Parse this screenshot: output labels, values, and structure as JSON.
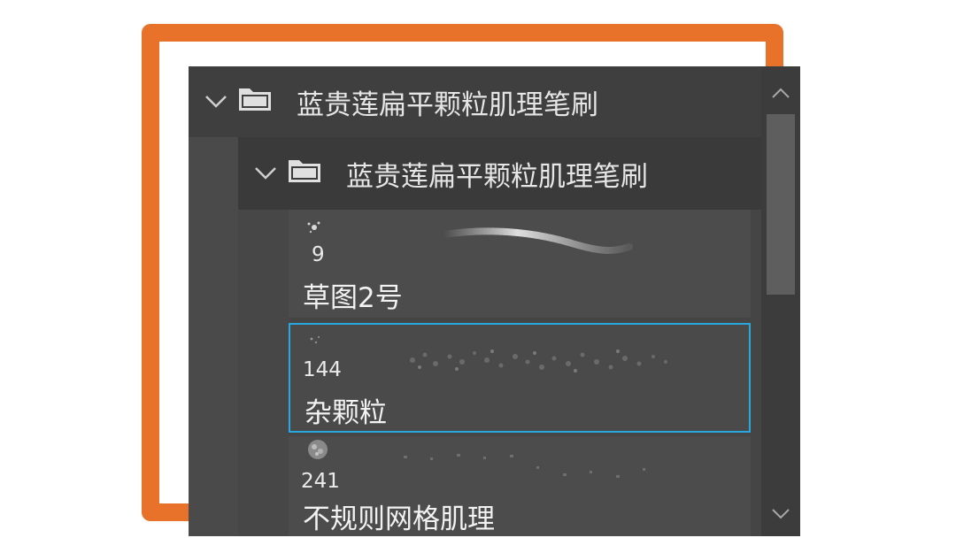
{
  "brush_panel": {
    "group_outer": {
      "label": "蓝贵莲扁平颗粒肌理笔刷",
      "expanded": true,
      "icon": "folder-icon"
    },
    "group_inner": {
      "label": "蓝贵莲扁平颗粒肌理笔刷",
      "expanded": true,
      "icon": "folder-icon"
    },
    "brushes": [
      {
        "size": "9",
        "name": "草图2号",
        "selected": false
      },
      {
        "size": "144",
        "name": "杂颗粒",
        "selected": true
      },
      {
        "size": "241",
        "name": "不规则网格肌理",
        "selected": false
      }
    ]
  },
  "colors": {
    "frame_accent": "#e8722a",
    "selection": "#29a8e0",
    "panel_bg": "#454545"
  },
  "icons": {
    "chevron": "chevron-down-icon",
    "folder": "folder-icon",
    "scroll_up": "chevron-up-icon",
    "scroll_down": "chevron-down-icon"
  }
}
